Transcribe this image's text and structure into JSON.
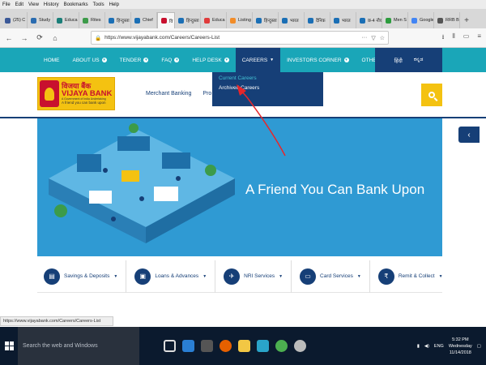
{
  "browser_menu": [
    "File",
    "Edit",
    "View",
    "History",
    "Bookmarks",
    "Tools",
    "Help"
  ],
  "tabs": [
    {
      "label": "(25) C",
      "color": "#3b5998"
    },
    {
      "label": "Study",
      "color": "#2b6cb0"
    },
    {
      "label": "Educa",
      "color": "#1b7f79"
    },
    {
      "label": "Rites",
      "color": "#3d9b4a"
    },
    {
      "label": "हिन्दुस्ता",
      "color": "#1b6fb5"
    },
    {
      "label": "Chief",
      "color": "#1b6fb5"
    },
    {
      "label": "वि",
      "color": "#c8102e",
      "active": true
    },
    {
      "label": "हिन्दुस्ता",
      "color": "#1b6fb5"
    },
    {
      "label": "Educa",
      "color": "#e03b3b"
    },
    {
      "label": "Listing",
      "color": "#f28c28"
    },
    {
      "label": "हिन्दुस्ता",
      "color": "#1b6fb5"
    },
    {
      "label": "भारत",
      "color": "#1b6fb5"
    },
    {
      "label": "दैनिक",
      "color": "#1b6fb5"
    },
    {
      "label": "भारत",
      "color": "#1b6fb5"
    },
    {
      "label": "छ-4 नौक",
      "color": "#1b6fb5"
    },
    {
      "label": "Men S",
      "color": "#2d9c3e"
    },
    {
      "label": "Google",
      "color": "#4285f4"
    },
    {
      "label": "RRB Bango",
      "color": "#555555"
    }
  ],
  "address_bar": {
    "url": "https://www.vijayabank.com/Careers/Careers-List"
  },
  "site_nav": {
    "items": [
      "HOME",
      "ABOUT US",
      "TENDER",
      "FAQ",
      "HELP DESK",
      "CAREERS",
      "INVESTORS CORNER",
      "OTHERS"
    ],
    "lang_hindi": "हिंदी",
    "lang_kannada": "ಕನ್ನಡ"
  },
  "careers_dropdown": {
    "items": [
      "Current Careers",
      "Archived Careers"
    ]
  },
  "logo": {
    "hindi": "विजया बैंक",
    "english": "VIJAYA BANK",
    "sub": "A Government of India Undertaking",
    "tagline": "A friend you can bank upon"
  },
  "submenu": {
    "items": [
      "Merchant Banking",
      "Pro"
    ]
  },
  "banner": {
    "headline": "A Friend You Can Bank Upon"
  },
  "services": [
    {
      "label": "Savings & Deposits",
      "icon": "savings-icon"
    },
    {
      "label": "Loans & Advances",
      "icon": "loan-icon"
    },
    {
      "label": "NRI Services",
      "icon": "nri-icon"
    },
    {
      "label": "Card Services",
      "icon": "card-icon"
    },
    {
      "label": "Remit & Collect",
      "icon": "remit-icon"
    }
  ],
  "status_url": "https://www.vijayabank.com/Careers/Careers-List",
  "taskbar": {
    "search_placeholder": "Search the web and Windows",
    "time": "5:32 PM",
    "day": "Wednesday",
    "date": "11/14/2018",
    "lang": "ENG"
  },
  "colors": {
    "teal": "#1aa6b8",
    "navy": "#163f77",
    "yellow": "#f4c211",
    "banner": "#2f9ad3",
    "red": "#c8102e",
    "annotation": "#e8262a"
  }
}
